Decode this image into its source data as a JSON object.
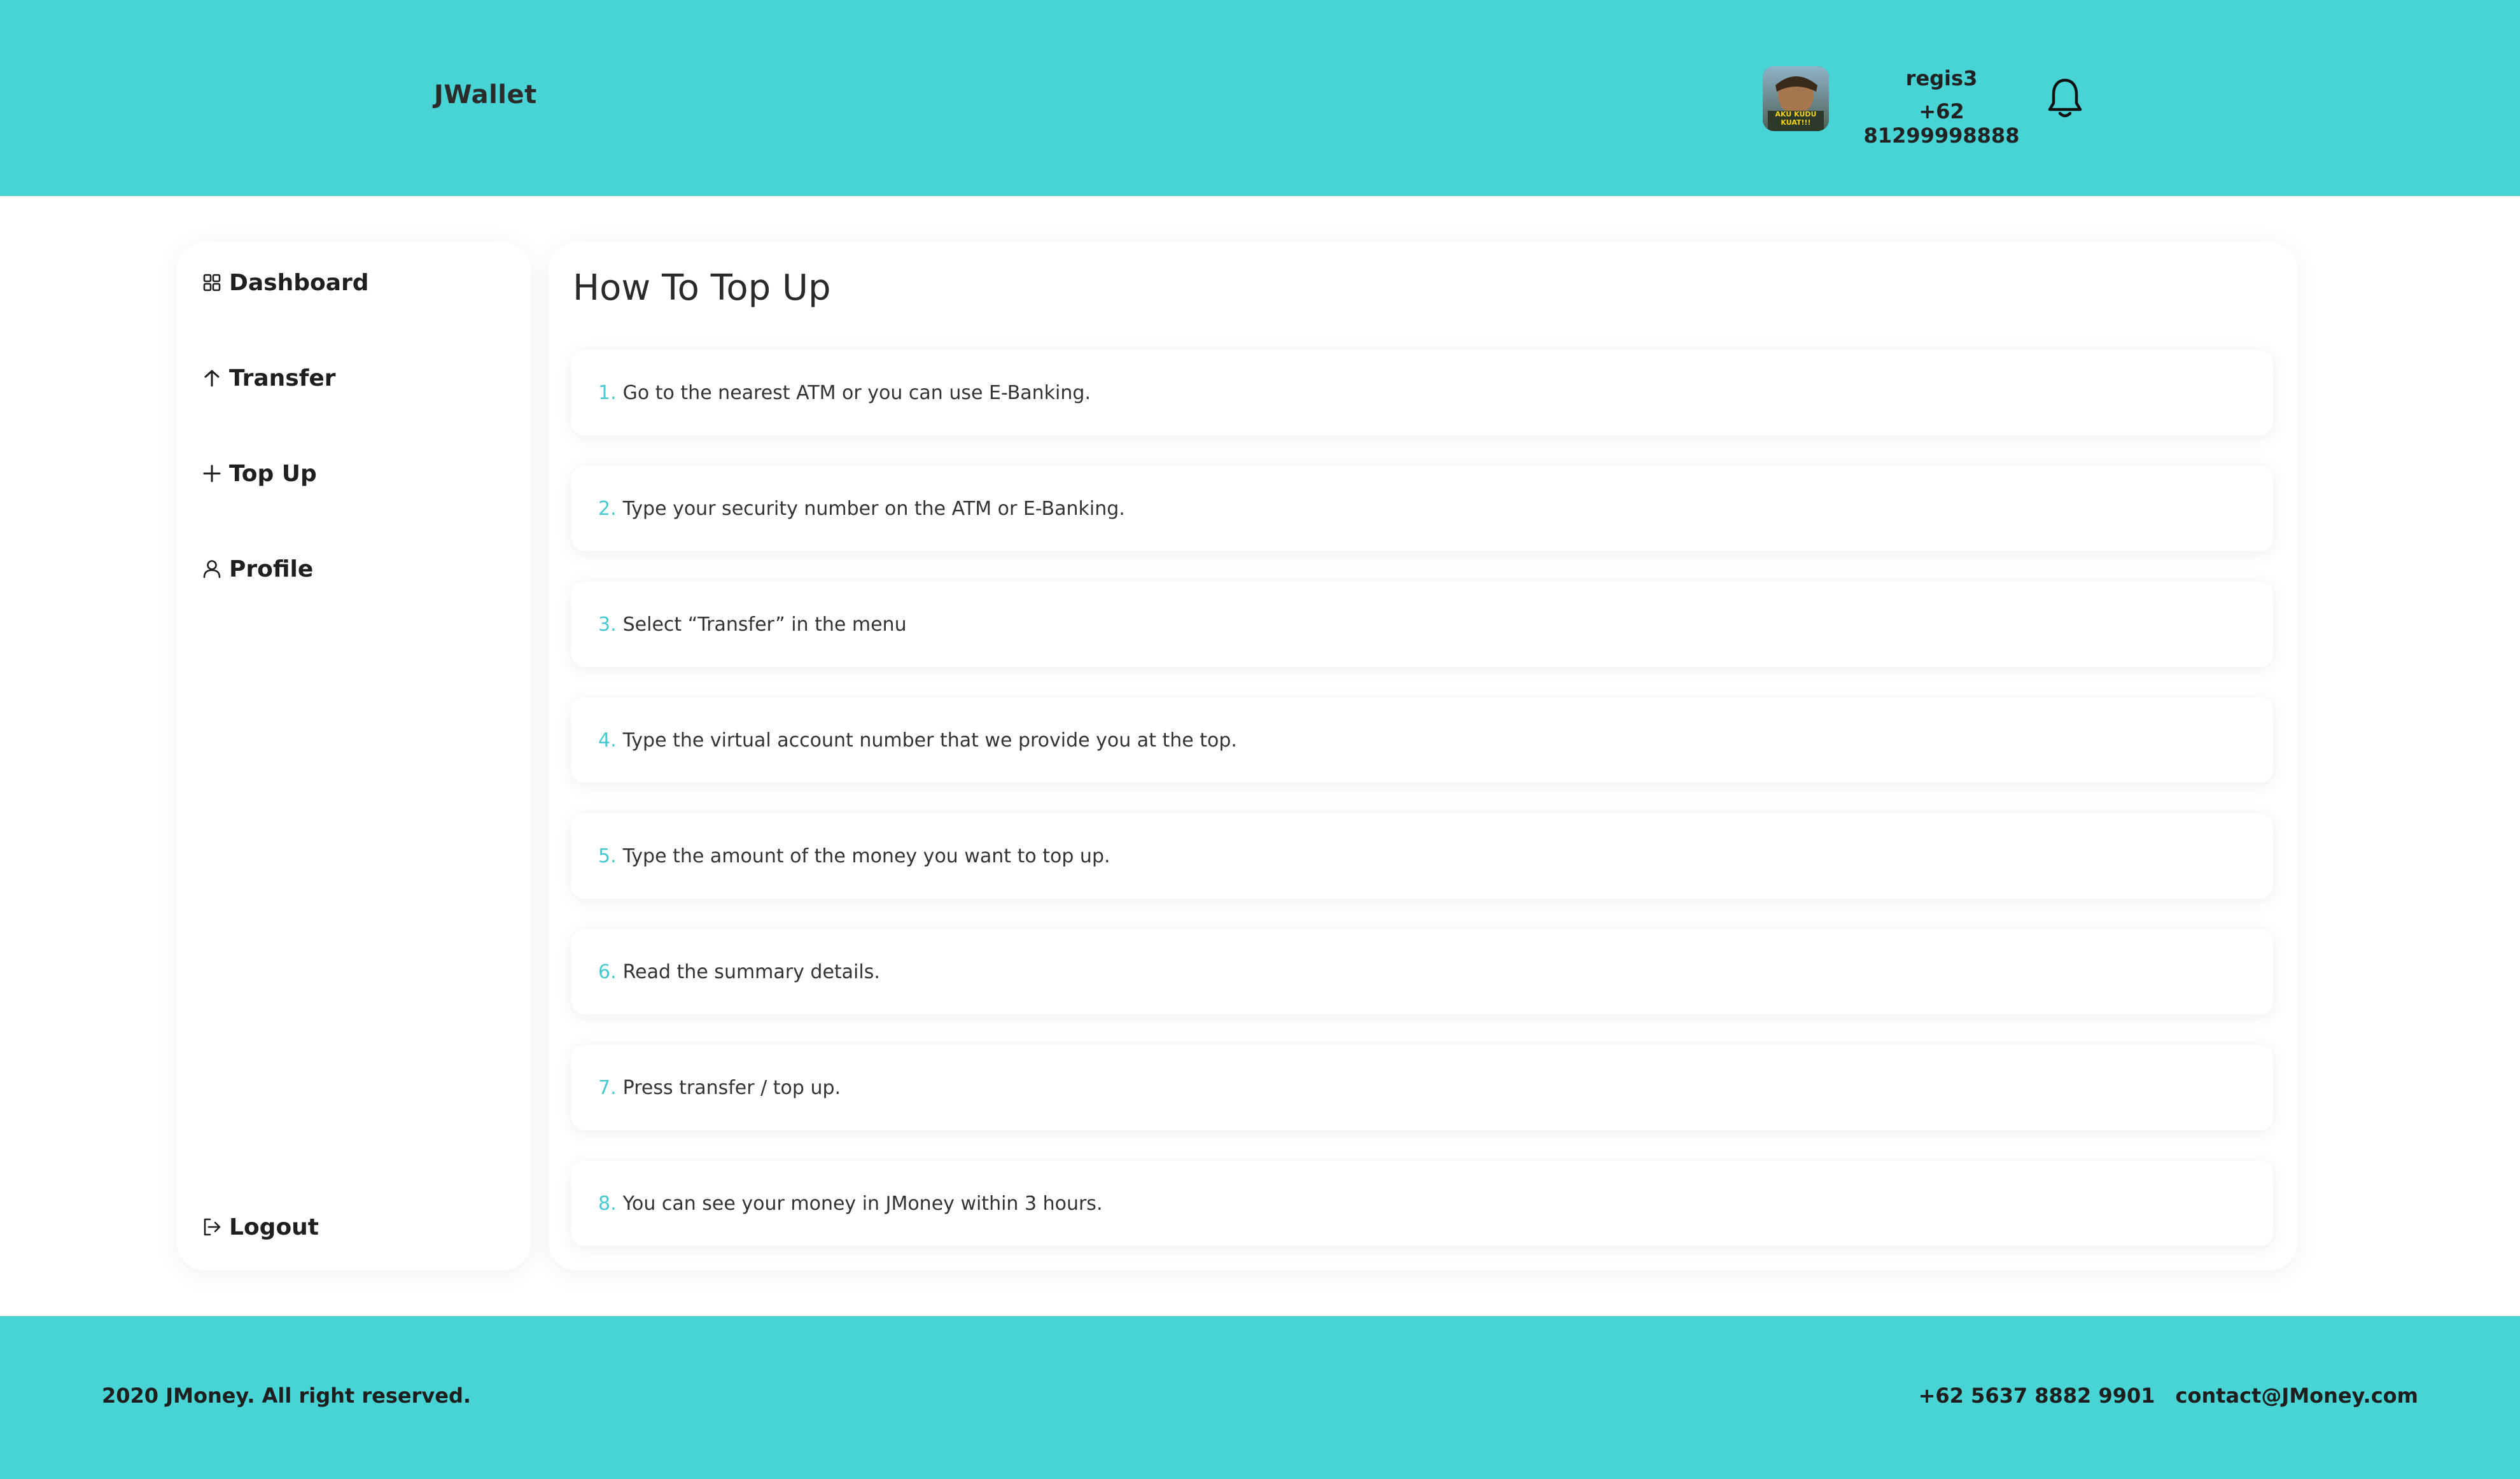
{
  "header": {
    "brand": "JWallet",
    "user": {
      "name": "regis3",
      "phone": "+62 81299998888",
      "avatar_text": "AKU KUDU KUAT!!!"
    },
    "icons": {
      "notification": "bell-icon"
    }
  },
  "sidebar": {
    "items": [
      {
        "label": "Dashboard",
        "icon": "grid-icon"
      },
      {
        "label": "Transfer",
        "icon": "arrow-up-icon"
      },
      {
        "label": "Top Up",
        "icon": "plus-icon"
      },
      {
        "label": "Profile",
        "icon": "user-icon"
      }
    ],
    "logout": {
      "label": "Logout",
      "icon": "logout-icon"
    }
  },
  "main": {
    "title": "How To Top Up",
    "steps": [
      {
        "num": "1.",
        "text": "Go to the nearest ATM or you can use E-Banking."
      },
      {
        "num": "2.",
        "text": "Type your security number on the ATM or E-Banking."
      },
      {
        "num": "3.",
        "text": "Select “Transfer” in the menu"
      },
      {
        "num": "4.",
        "text": "Type the virtual account number that we provide you at the top."
      },
      {
        "num": "5.",
        "text": "Type the amount of the money you want to top up."
      },
      {
        "num": "6.",
        "text": "Read the summary details."
      },
      {
        "num": "7.",
        "text": "Press transfer / top up."
      },
      {
        "num": "8.",
        "text": "You can see your money in JMoney within 3 hours."
      }
    ]
  },
  "footer": {
    "copyright": "2020 JMoney. All right reserved.",
    "phone": "+62 5637 8882 9901",
    "email": "contact@JMoney.com"
  },
  "colors": {
    "accent": "#48d3d5",
    "step_number": "#48c8d0",
    "text": "#1f1f1f",
    "card_bg": "#ffffff"
  }
}
